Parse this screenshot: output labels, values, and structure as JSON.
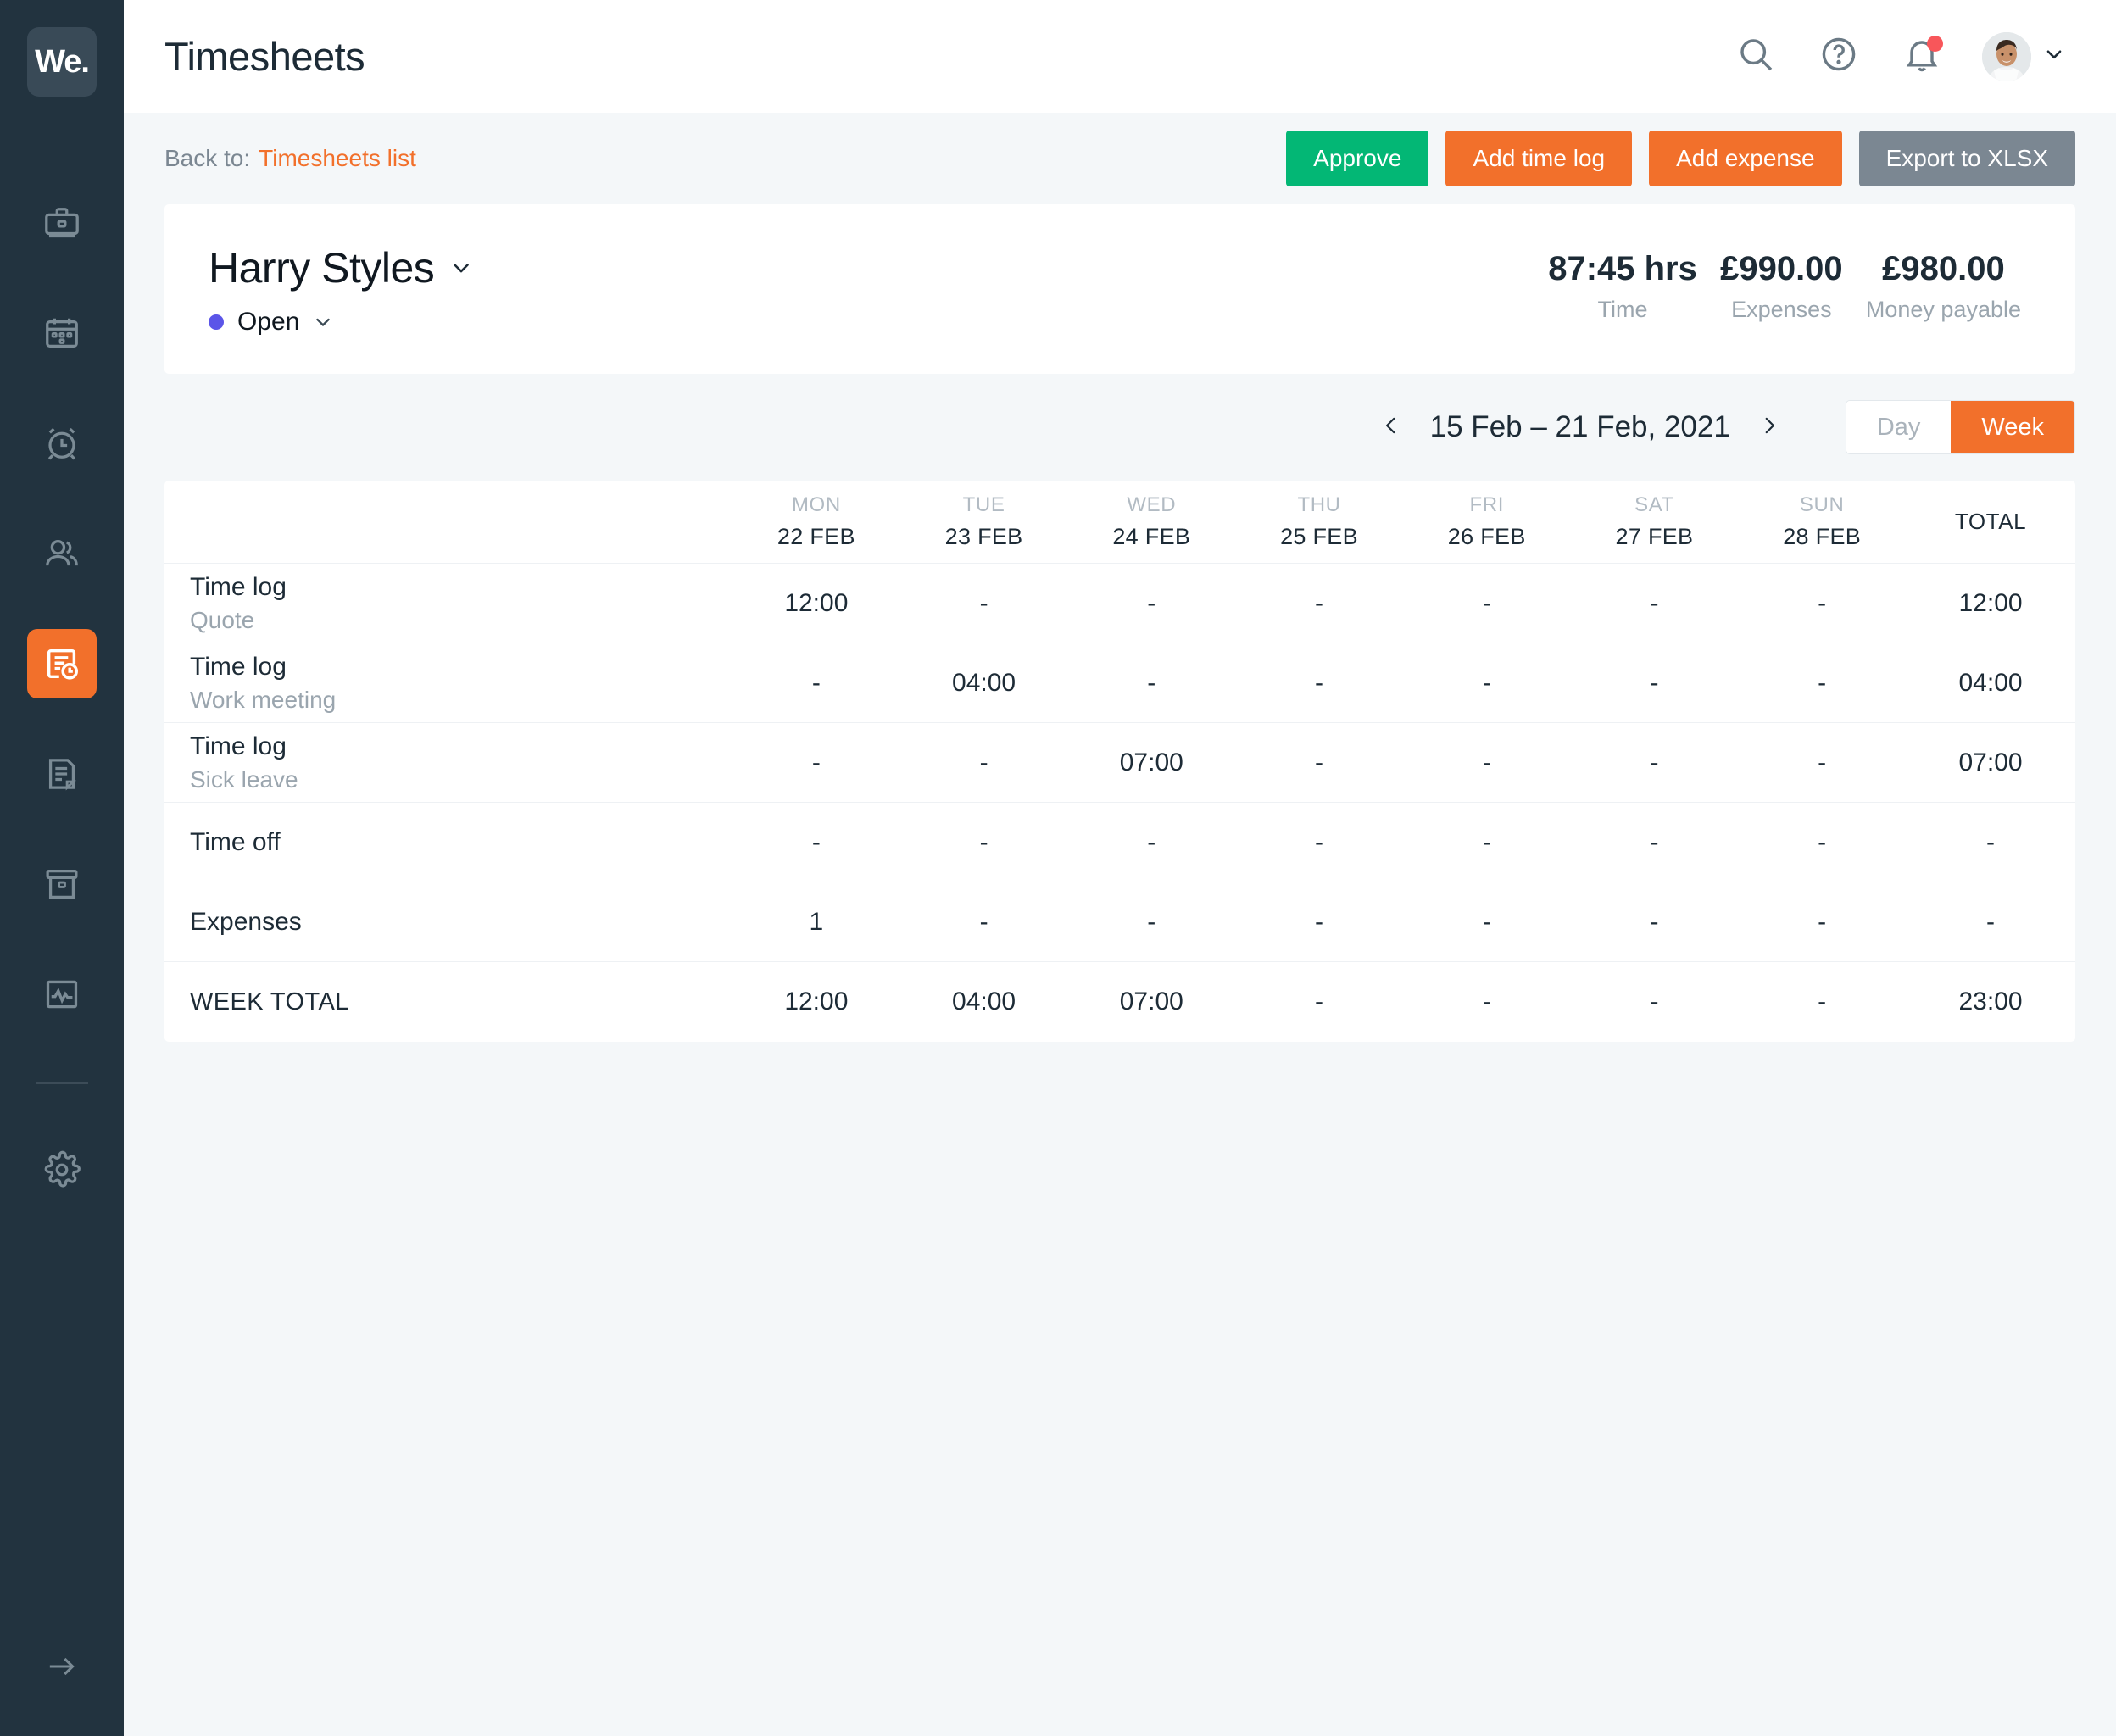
{
  "sidebar": {
    "logo_text": "We.",
    "items": [
      {
        "name": "briefcase",
        "label": "Projects",
        "active": false
      },
      {
        "name": "calendar",
        "label": "Calendar",
        "active": false
      },
      {
        "name": "alarm-clock",
        "label": "Time tracking",
        "active": false
      },
      {
        "name": "people",
        "label": "People",
        "active": false
      },
      {
        "name": "timesheet",
        "label": "Timesheets",
        "active": true
      },
      {
        "name": "document",
        "label": "Documents",
        "active": false
      },
      {
        "name": "archive-box",
        "label": "Archive",
        "active": false
      },
      {
        "name": "chart-activity",
        "label": "Reports",
        "active": false
      },
      {
        "name": "gear",
        "label": "Settings",
        "active": false
      }
    ],
    "collapse_label": "Collapse sidebar"
  },
  "header": {
    "title": "Timesheets",
    "icons": [
      "search-icon",
      "help-icon",
      "bell-icon"
    ],
    "has_notification": true,
    "avatar_alt": "User avatar"
  },
  "actionbar": {
    "back_prefix": "Back to:",
    "back_link": "Timesheets list",
    "buttons": [
      {
        "label": "Approve",
        "style": "green"
      },
      {
        "label": "Add time log",
        "style": "orange"
      },
      {
        "label": "Add expense",
        "style": "orange"
      },
      {
        "label": "Export to XLSX",
        "style": "grey"
      }
    ]
  },
  "summary": {
    "employee_name": "Harry Styles",
    "status": "Open",
    "status_color": "#5b55e8",
    "stats": [
      {
        "value": "87:45 hrs",
        "label": "Time"
      },
      {
        "value": "£990.00",
        "label": "Expenses"
      },
      {
        "value": "£980.00",
        "label": "Money payable"
      }
    ]
  },
  "datebar": {
    "prev_label": "Previous week",
    "range": "15 Feb – 21 Feb, 2021",
    "next_label": "Next week",
    "view_day": "Day",
    "view_week": "Week",
    "active_view": "Week"
  },
  "table": {
    "columns": [
      {
        "day": "MON",
        "date": "22 FEB"
      },
      {
        "day": "TUE",
        "date": "23 FEB"
      },
      {
        "day": "WED",
        "date": "24 FEB"
      },
      {
        "day": "THU",
        "date": "25 FEB"
      },
      {
        "day": "FRI",
        "date": "26 FEB"
      },
      {
        "day": "SAT",
        "date": "27 FEB"
      },
      {
        "day": "SUN",
        "date": "28 FEB"
      }
    ],
    "total_header": "TOTAL",
    "rows": [
      {
        "title": "Time log",
        "sub": "Quote",
        "values": [
          "12:00",
          "-",
          "-",
          "-",
          "-",
          "-",
          "-"
        ],
        "total": "12:00"
      },
      {
        "title": "Time log",
        "sub": "Work meeting",
        "values": [
          "-",
          "04:00",
          "-",
          "-",
          "-",
          "-",
          "-"
        ],
        "total": "04:00"
      },
      {
        "title": "Time log",
        "sub": "Sick leave",
        "values": [
          "-",
          "-",
          "07:00",
          "-",
          "-",
          "-",
          "-"
        ],
        "total": "07:00"
      },
      {
        "title": "Time off",
        "sub": "",
        "values": [
          "-",
          "-",
          "-",
          "-",
          "-",
          "-",
          "-"
        ],
        "total": "-"
      },
      {
        "title": "Expenses",
        "sub": "",
        "values": [
          "1",
          "-",
          "-",
          "-",
          "-",
          "-",
          "-"
        ],
        "total": "-"
      }
    ],
    "week_total": {
      "label": "WEEK TOTAL",
      "values": [
        "12:00",
        "04:00",
        "07:00",
        "-",
        "-",
        "-",
        "-"
      ],
      "total": "23:00"
    }
  },
  "colors": {
    "sidebar_bg": "#22333f",
    "accent_orange": "#f2702b",
    "green": "#03b775",
    "grey_btn": "#7b8792",
    "page_bg": "#f4f7f9",
    "text_dark": "#1d2b36"
  }
}
